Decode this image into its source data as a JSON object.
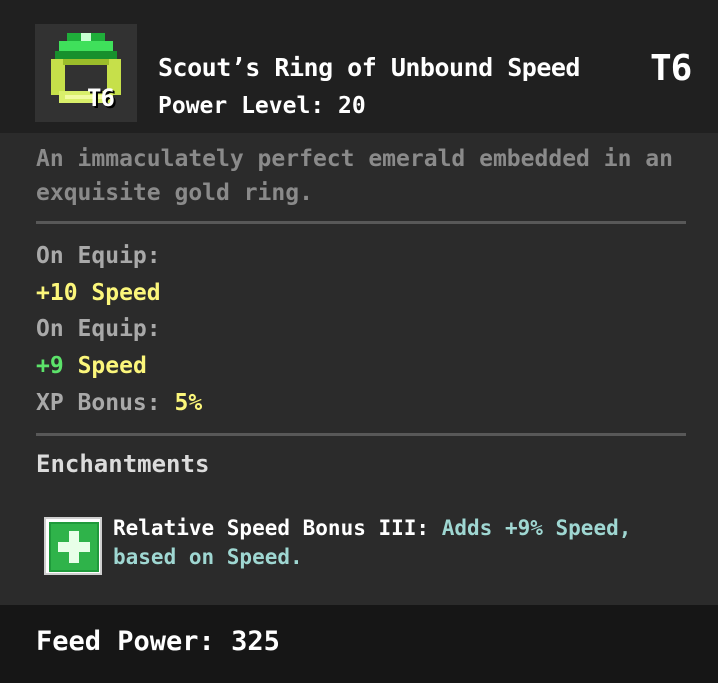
{
  "item": {
    "icon_name": "emerald-ring-icon",
    "icon_tier": "T6",
    "name": "Scout’s Ring of Unbound Speed",
    "tier": "T6",
    "power_level": "Power Level: 20"
  },
  "description": "An immaculately perfect emerald embedded in an exquisite gold ring.",
  "stats": {
    "on_equip_label_1": "On Equip:",
    "stat_1": "+10 Speed",
    "on_equip_label_2": "On Equip:",
    "stat_2_value": "+9",
    "stat_2_name": "Speed",
    "xp_bonus_label": "XP Bonus:",
    "xp_bonus_value": "5%"
  },
  "enchantments": {
    "title": "Enchantments",
    "items": [
      {
        "icon_name": "green-plus-icon",
        "name": "Relative Speed Bonus III:",
        "description": "Adds +9% Speed, based on Speed."
      }
    ]
  },
  "footer": {
    "feed_power": "Feed Power: 325"
  },
  "colors": {
    "stat_yellow": "#fbf67b",
    "stat_green": "#5ce36a",
    "enchant_desc": "#9fd7d2",
    "description_gray": "#8a8a8a"
  }
}
